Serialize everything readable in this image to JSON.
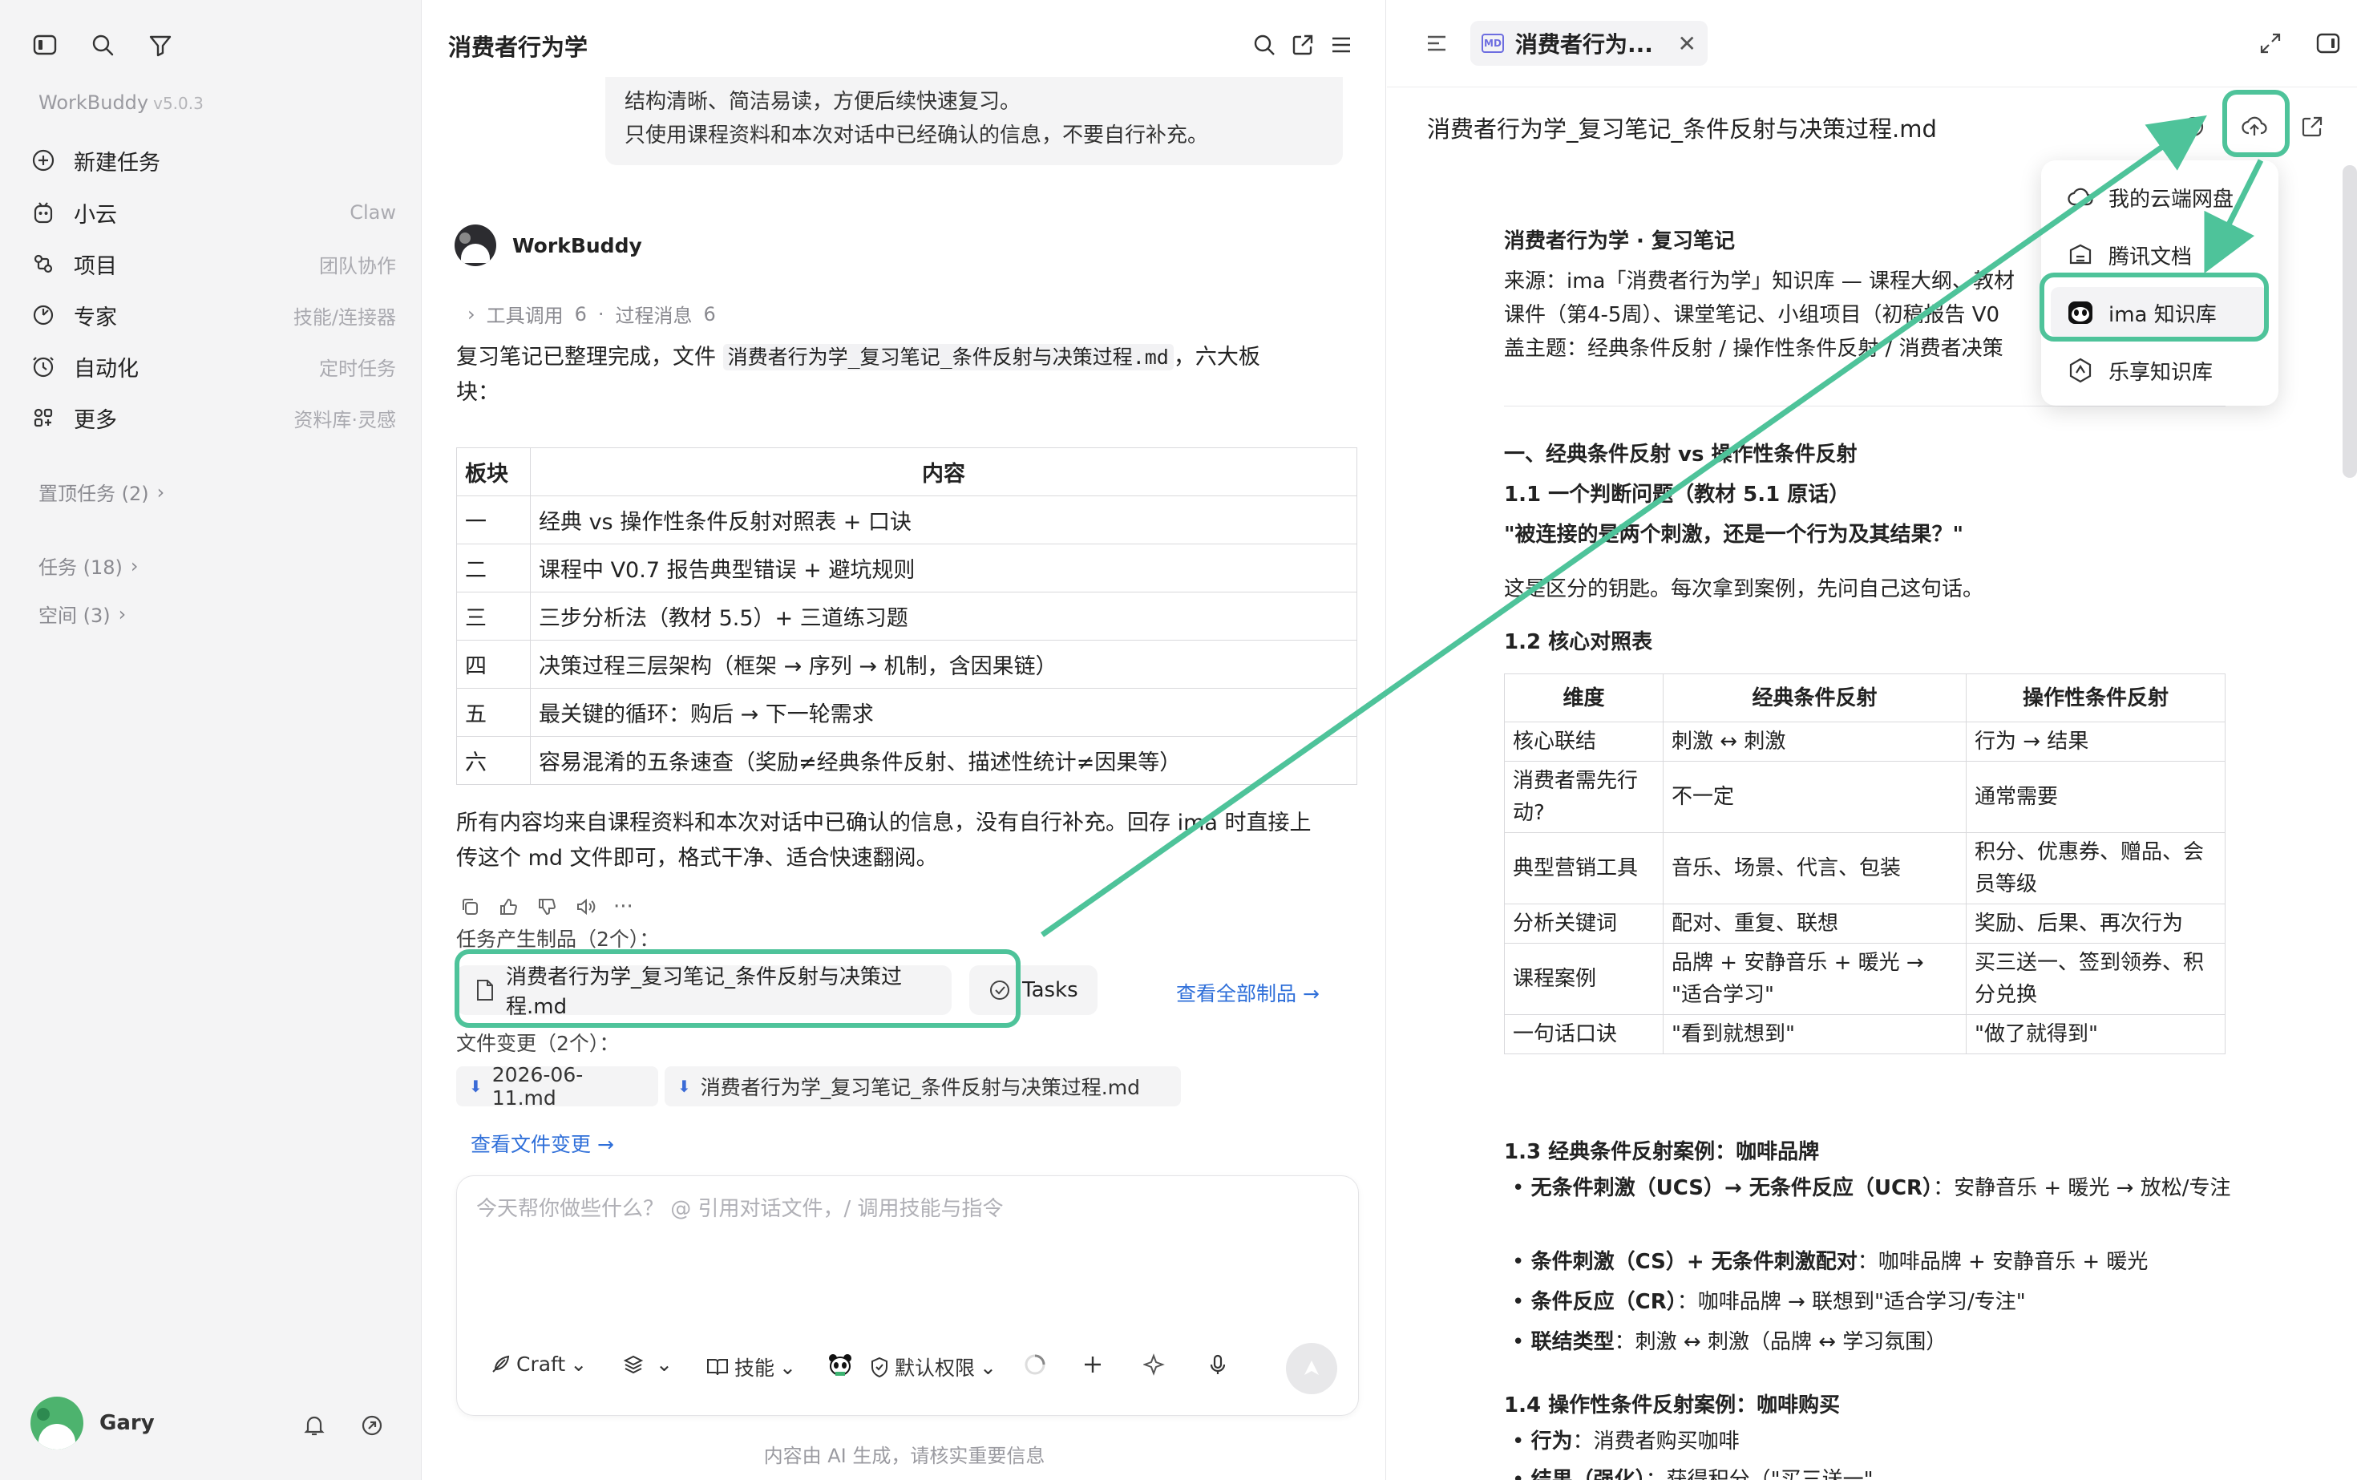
{
  "app": {
    "name": "WorkBuddy",
    "version": "v5.0.3"
  },
  "sidebar": {
    "items": [
      {
        "label": "新建任务",
        "hint": "",
        "icon": "plus-circle-icon"
      },
      {
        "label": "小云",
        "hint": "Claw",
        "icon": "bot-icon"
      },
      {
        "label": "项目",
        "hint": "团队协作",
        "icon": "project-icon"
      },
      {
        "label": "专家",
        "hint": "技能/连接器",
        "icon": "expert-icon"
      },
      {
        "label": "自动化",
        "hint": "定时任务",
        "icon": "clock-icon"
      },
      {
        "label": "更多",
        "hint": "资料库·灵感",
        "icon": "grid-icon"
      }
    ],
    "sections": [
      "置顶任务 (2)",
      "任务 (18)",
      "空间 (3)"
    ],
    "user": "Gary"
  },
  "chat": {
    "title": "消费者行为学",
    "prev_lines": [
      "结构清晰、简洁易读，方便后续快速复习。",
      "只使用课程资料和本次对话中已经确认的信息，不要自行补充。"
    ],
    "bot_name": "WorkBuddy",
    "tools_label": "工具调用",
    "tools_count": "6",
    "process_label": "过程消息",
    "process_count": "6",
    "intro_before": "复习笔记已整理完成，文件",
    "intro_file": "消费者行为学_复习笔记_条件反射与决策过程.md",
    "intro_after": "，六大板",
    "intro_line2": "块：",
    "table_headers": [
      "板块",
      "内容"
    ],
    "table_rows": [
      [
        "一",
        "经典 vs 操作性条件反射对照表 + 口诀"
      ],
      [
        "二",
        "课程中 V0.7 报告典型错误 + 避坑规则"
      ],
      [
        "三",
        "三步分析法（教材 5.5）+ 三道练习题"
      ],
      [
        "四",
        "决策过程三层架构（框架 → 序列 → 机制，含因果链）"
      ],
      [
        "五",
        "最关键的循环：购后 → 下一轮需求"
      ],
      [
        "六",
        "容易混淆的五条速查（奖励≠经典条件反射、描述性统计≠因果等）"
      ]
    ],
    "conclusion_line1": "所有内容均来自课程资料和本次对话中已确认的信息，没有自行补充。回存 ima 时直接上",
    "conclusion_line2": "传这个 md 文件即可，格式干净、适合快速翻阅。",
    "artifacts_label": "任务产生制品（2个）：",
    "artifact_file": "消费者行为学_复习笔记_条件反射与决策过程.md",
    "artifact_tasks": "Tasks",
    "view_all": "查看全部制品 →",
    "changes_label": "文件变更（2个）：",
    "change_files": [
      "2026-06-11.md",
      "消费者行为学_复习笔记_条件反射与决策过程.md"
    ],
    "view_changes": "查看文件变更 →",
    "input_placeholder": "今天帮你做些什么？ @ 引用对话文件，/ 调用技能与指令",
    "toolbar": {
      "craft": "Craft",
      "skills": "技能",
      "permission": "默认权限"
    },
    "disclaimer": "内容由 AI 生成，请核实重要信息"
  },
  "doc": {
    "tab_label": "消费者行为...",
    "tab_badge": "MD",
    "title": "消费者行为学_复习笔记_条件反射与决策过程.md",
    "heading": "消费者行为学 · 复习笔记",
    "source_lines": [
      "来源：ima「消费者行为学」知识库 — 课程大纲、教材",
      "课件（第4-5周）、课堂笔记、小组项目（初稿报告 V0",
      "盖主题：经典条件反射 / 操作性条件反射 / 消费者决策"
    ],
    "h1": "一、经典条件反射 vs 操作性条件反射",
    "h11": "1.1 一个判断问题（教材 5.1 原话）",
    "quote": "\"被连接的是两个刺激，还是一个行为及其结果？\"",
    "p1": "这是区分的钥匙。每次拿到案例，先问自己这句话。",
    "h12": "1.2 核心对照表",
    "table_headers": [
      "维度",
      "经典条件反射",
      "操作性条件反射"
    ],
    "table_rows": [
      [
        "核心联结",
        "刺激 ↔ 刺激",
        "行为 → 结果"
      ],
      [
        "消费者需先行动?",
        "不一定",
        "通常需要"
      ],
      [
        "典型营销工具",
        "音乐、场景、代言、包装",
        "积分、优惠券、赠品、会员等级"
      ],
      [
        "分析关键词",
        "配对、重复、联想",
        "奖励、后果、再次行为"
      ],
      [
        "课程案例",
        "品牌 + 安静音乐 + 暖光 → \"适合学习\"",
        "买三送一、签到领券、积分兑换"
      ],
      [
        "一句话口诀",
        "\"看到就想到\"",
        "\"做了就得到\""
      ]
    ],
    "h13": "1.3 经典条件反射案例：咖啡品牌",
    "bullets13": [
      {
        "k": "无条件刺激（UCS）→ 无条件反应（UCR）",
        "v": "：安静音乐 + 暖光 → 放松/专注"
      },
      {
        "k": "条件刺激（CS）+ 无条件刺激配对",
        "v": "：咖啡品牌 + 安静音乐 + 暖光"
      },
      {
        "k": "条件反应（CR）",
        "v": "：咖啡品牌 → 联想到\"适合学习/专注\""
      },
      {
        "k": "联结类型",
        "v": "：刺激 ↔ 刺激（品牌 ↔ 学习氛围）"
      }
    ],
    "h14": "1.4 操作性条件反射案例：咖啡购买",
    "bullets14": [
      {
        "k": "行为",
        "v": "：消费者购买咖啡"
      },
      {
        "k": "结果（强化）",
        "v": "：获得积分（\"买三送一\""
      }
    ],
    "dropdown": [
      {
        "label": "我的云端网盘",
        "icon": "cloud-icon"
      },
      {
        "label": "腾讯文档",
        "icon": "doc-icon"
      },
      {
        "label": "ima 知识库",
        "icon": "panda-icon"
      },
      {
        "label": "乐享知识库",
        "icon": "hex-icon"
      }
    ]
  },
  "colors": {
    "accent": "#4ec39a",
    "link": "#2f6fd9",
    "sidebar_bg": "#f4f4f5"
  }
}
